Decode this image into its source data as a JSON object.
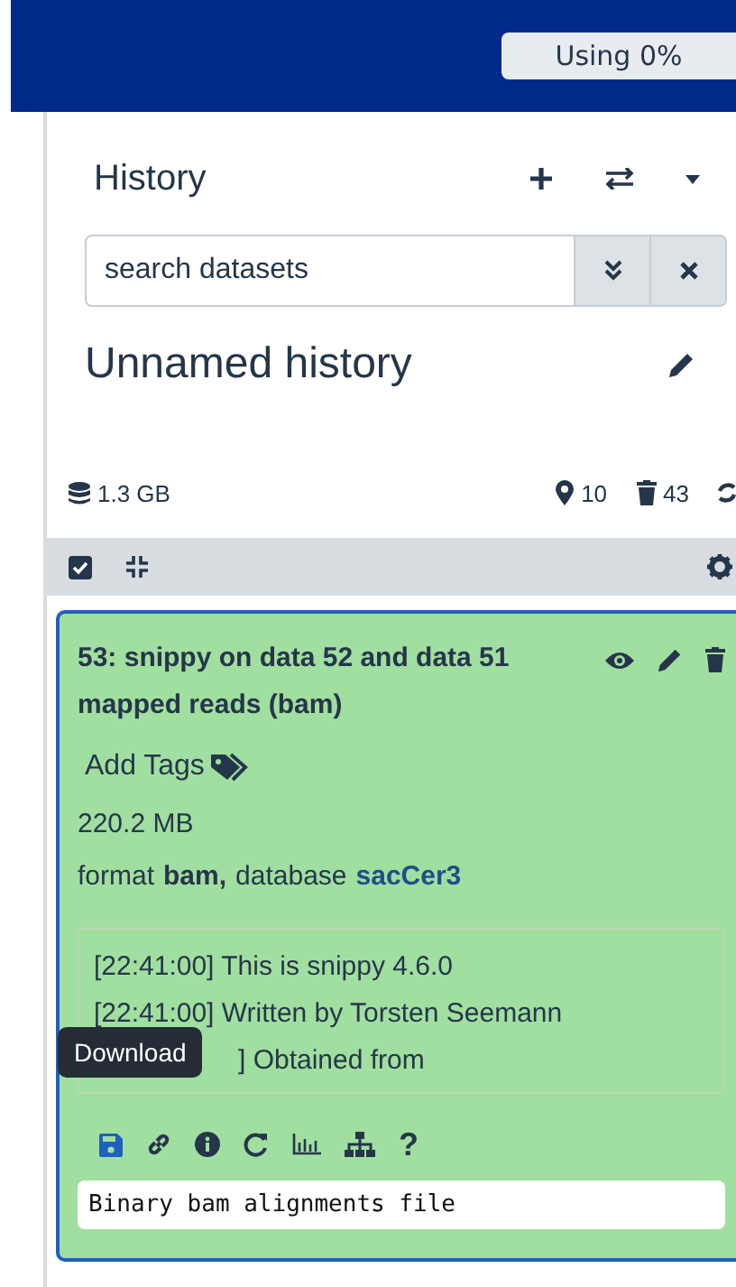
{
  "top_bar": {
    "quota": "Using 0%"
  },
  "history": {
    "title": "History",
    "search": {
      "placeholder": "search datasets"
    },
    "name": "Unnamed history",
    "stats": {
      "size": "1.3 GB",
      "shown": "10",
      "deleted": "43"
    }
  },
  "dataset": {
    "title": "53: snippy on data 52 and data 51 mapped reads (bam)",
    "add_tags": "Add Tags",
    "size": "220.2 MB",
    "format_label": "format",
    "format": "bam,",
    "database_label": "database",
    "database": "sacCer3",
    "log": [
      "[22:41:00] This is snippy 4.6.0",
      "[22:41:00] Written by Torsten Seemann",
      "] Obtained from"
    ],
    "tooltip": "Download",
    "help": "?",
    "description": "Binary bam alignments file"
  }
}
